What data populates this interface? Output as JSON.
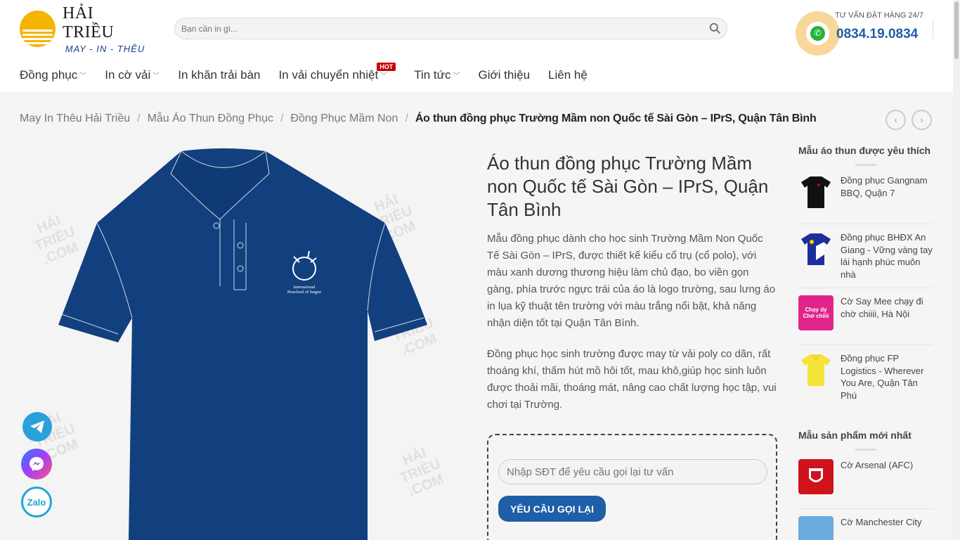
{
  "header": {
    "logo_title": "HẢI TRIỀU",
    "logo_sub": "MAY - IN - THÊU",
    "search_placeholder": "Bạn cần in gì...",
    "hotline_label": "TƯ VẤN ĐẶT HÀNG 24/7",
    "hotline_number": "0834.19.0834"
  },
  "nav": {
    "items": [
      {
        "label": "Đồng phục"
      },
      {
        "label": "In cờ vải"
      },
      {
        "label": "In khăn trải bàn"
      },
      {
        "label": "In vải chuyển nhiệt",
        "badge": "HOT"
      },
      {
        "label": "Tin tức"
      },
      {
        "label": "Giới thiệu"
      },
      {
        "label": "Liên hệ"
      }
    ]
  },
  "breadcrumb": {
    "items": [
      "May In Thêu Hải Triều",
      "Mẫu Áo Thun Đồng Phục",
      "Đồng Phục Mầm Non"
    ],
    "current": "Áo thun đồng phục Trường Mầm non Quốc tế Sài Gòn – IPrS, Quận Tân Bình",
    "separator": "/"
  },
  "product": {
    "title": "Áo thun đồng phục Trường Mầm non Quốc tế Sài Gòn – IPrS, Quận Tân Bình",
    "desc_1": "Mẫu đồng phục dành cho học sinh Trường Mầm Non Quốc Tế Sài Gòn – IPrS, được thiết kế kiểu cổ trụ (cổ polo), với màu xanh dương thương hiệu làm chủ đạo, bo viền gọn gàng, phía trước ngực trái của áo là logo trường, sau lưng áo in lụa kỹ thuật tên trường với màu trắng nổi bật, khả năng nhận diện tốt tại Quận Tân Bình.",
    "desc_2": "Đồng phục học sinh trường được may từ vải poly co dãn, rất thoáng khí, thấm hút mồ hôi tốt, mau khô,giúp học sinh luôn được thoải mãi, thoáng mát, nâng cao chất lượng học tập, vui chơi tại Trường.",
    "shirt_logo_line1": "International",
    "shirt_logo_line2": "Preschool of Saigon",
    "shirt_color": "#12407f",
    "watermark": "HẢI TRIỀU .COM"
  },
  "callback": {
    "placeholder": "Nhập SĐT để yêu cầu gọi lại tư vấn",
    "button": "YÊU CẦU GỌI LẠI"
  },
  "sidebar": {
    "favorites_heading": "Mẫu áo thun được yêu thích",
    "favorites": [
      {
        "title": "Đồng phục Gangnam BBQ, Quận 7"
      },
      {
        "title": "Đồng phục BHĐX An Giang - Vững vàng tay lái hạnh phúc muôn nhà"
      },
      {
        "title": "Cờ Say Mee chạy đi chờ chiiii, Hà Nội",
        "thumb_text": "Chạy dy Chờ chiiii"
      },
      {
        "title": "Đồng phục FP Logistics - Wherever You Are, Quận Tân Phú"
      }
    ],
    "newest_heading": "Mẫu sản phẩm mới nhất",
    "newest": [
      {
        "title": "Cờ Arsenal (AFC)"
      },
      {
        "title": "Cờ Manchester City"
      }
    ]
  },
  "social": {
    "zalo_label": "Zalo"
  },
  "colors": {
    "primary": "#1e5fa8",
    "accent": "#f5b400",
    "hot": "#cc0000",
    "telegram": "#2aa1da",
    "zalo": "#1fa6d8"
  }
}
